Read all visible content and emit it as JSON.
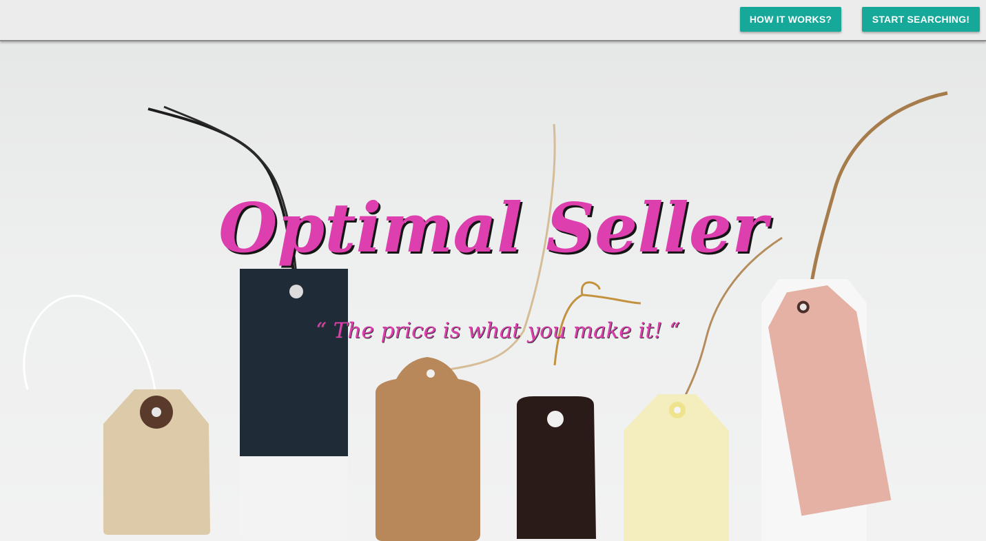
{
  "nav": {
    "how_it_works_label": "HOW IT WORKS?",
    "start_searching_label": "START SEARCHING!"
  },
  "hero": {
    "title": "Optimal Seller",
    "tagline": "“ The price is what you make it! “"
  },
  "colors": {
    "accent": "#16a99a",
    "title_pink": "#dd3fae",
    "title_shadow": "#151515"
  }
}
